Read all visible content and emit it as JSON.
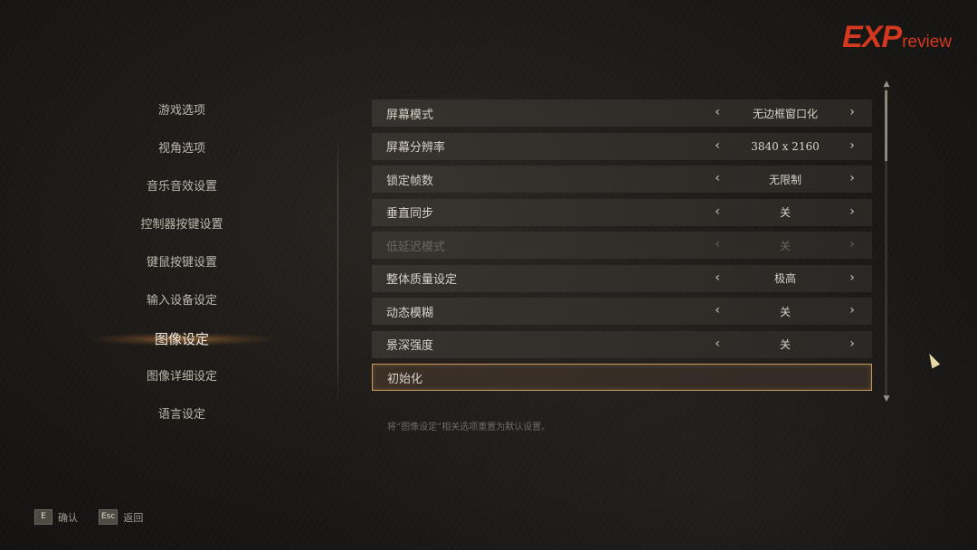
{
  "logo": {
    "exp": "EXP",
    "review": "review"
  },
  "menu": {
    "items": [
      {
        "label": "游戏选项",
        "active": false
      },
      {
        "label": "视角选项",
        "active": false
      },
      {
        "label": "音乐音效设置",
        "active": false
      },
      {
        "label": "控制器按键设置",
        "active": false
      },
      {
        "label": "键鼠按键设置",
        "active": false
      },
      {
        "label": "输入设备设定",
        "active": false
      },
      {
        "label": "图像设定",
        "active": true
      },
      {
        "label": "图像详细设定",
        "active": false
      },
      {
        "label": "语言设定",
        "active": false
      }
    ]
  },
  "settings": {
    "rows": [
      {
        "label": "屏幕模式",
        "value": "无边框窗口化",
        "disabled": false
      },
      {
        "label": "屏幕分辨率",
        "value": "3840 x 2160",
        "disabled": false
      },
      {
        "label": "锁定帧数",
        "value": "无限制",
        "disabled": false
      },
      {
        "label": "垂直同步",
        "value": "关",
        "disabled": false
      },
      {
        "label": "低延迟模式",
        "value": "关",
        "disabled": true
      },
      {
        "label": "整体质量设定",
        "value": "极高",
        "disabled": false
      },
      {
        "label": "动态模糊",
        "value": "关",
        "disabled": false
      },
      {
        "label": "景深强度",
        "value": "关",
        "disabled": false
      }
    ],
    "reset_label": "初始化",
    "arrow_left": "‹",
    "arrow_right": "›"
  },
  "description": "将“图像设定”相关选项重置为默认设置。",
  "footer": {
    "confirm_key": "E",
    "confirm_label": "确认",
    "back_key": "Esc",
    "back_label": "返回"
  },
  "colors": {
    "accent": "#c79a63",
    "logo": "#d4381f",
    "background": "#1d1a17"
  }
}
